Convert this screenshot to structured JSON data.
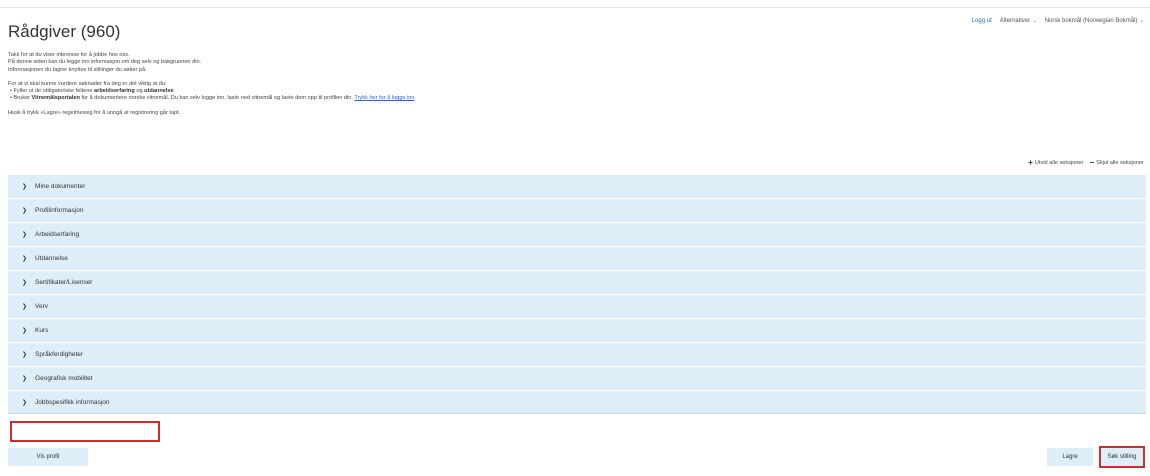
{
  "topnav": {
    "logout": "Logg ut",
    "options": "Alternativer",
    "language": "Norsk bokmål (Norwegian Bokmål)"
  },
  "page": {
    "title": "Rådgiver (960)"
  },
  "intro": {
    "line1": "Takk for at du viser interesse for å jobbe hos oss.",
    "line2": "På denne siden kan du legge inn informasjon om deg selv og bakgrunnen din.",
    "line3": "Informasjonen du lagrer knyttes til stillinger du søker på.",
    "line4": "For at vi skal kunne vurdere søknader fra deg er det viktig at du:",
    "bullet1_pre": "•  Fyller ut de obligatoriske feltene ",
    "bullet1_bold1": "arbeidserfaring",
    "bullet1_mid": " og ",
    "bullet1_bold2": "utdannelse",
    "bullet2_pre": "•  Bruker ",
    "bullet2_bold": "Vitnemålsportalen",
    "bullet2_post": " for å dokumentere norske vitnemål. Du kan selv logge inn, laste ned vitnemål og laste dem opp til profilen din. ",
    "bullet2_link": "Trykk her for å logge inn",
    "line5": "Husk å trykk «Lagre» regelmessig for å unngå at registrering går tapt."
  },
  "section_controls": {
    "expand_all": "Utvid alle seksjoner",
    "collapse_all": "Skjul alle seksjoner"
  },
  "sections": [
    {
      "label": "Mine dokumenter"
    },
    {
      "label": "Profilinformasjon"
    },
    {
      "label": "Arbeidserfaring"
    },
    {
      "label": "Utdannelse"
    },
    {
      "label": "Sertifikater/Lisenser"
    },
    {
      "label": "Verv"
    },
    {
      "label": "Kurs"
    },
    {
      "label": "Språkferdigheter"
    },
    {
      "label": "Geografisk mobilitet"
    },
    {
      "label": "Jobbspesifikk informasjon"
    }
  ],
  "buttons": {
    "view_profile": "Vis profil",
    "save": "Lagre",
    "apply": "Søk stilling"
  },
  "colors": {
    "section_bg": "#ddeef9",
    "highlight": "#c9302c",
    "link": "#2a6ab3"
  }
}
